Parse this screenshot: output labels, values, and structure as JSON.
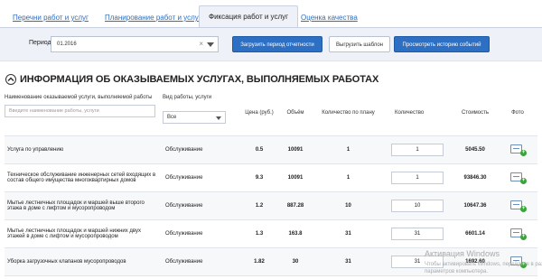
{
  "tabs": [
    {
      "label": "Перечни работ и услуг"
    },
    {
      "label": "Планирование работ и услуг"
    },
    {
      "label": "Фиксация работ и услуг"
    },
    {
      "label": "Оценка качества"
    }
  ],
  "filter": {
    "period_label": "Период",
    "period_value": "01.2016",
    "clear_glyph": "×",
    "load_button": "Загрузить период отчетности",
    "template_button": "Выгрузить шаблон",
    "history_button": "Просмотреть историю событий"
  },
  "section": {
    "title": "ИНФОРМАЦИЯ ОБ ОКАЗЫВАЕМЫХ УСЛУГАХ, ВЫПОЛНЯЕМЫХ РАБОТАХ"
  },
  "table": {
    "headers": {
      "name": "Наименование оказываемой услуги, выполняемой работы",
      "name_placeholder": "Введите наименование работы, услуги",
      "type": "Вид работы, услуги",
      "type_select": "Все",
      "price": "Цена (руб.)",
      "volume": "Объём",
      "planned": "Количество по плану",
      "quantity": "Количество",
      "cost": "Стоимость",
      "photo": "Фото"
    },
    "rows": [
      {
        "name": "Услуга по управлению",
        "type": "Обслуживание",
        "price": "0.5",
        "volume": "10091",
        "planned": "1",
        "quantity": "1",
        "cost": "5045.50"
      },
      {
        "name": "Техническое обслуживание инженерных сетей входящих в состав общего имущества многоквартирных домов",
        "type": "Обслуживание",
        "price": "9.3",
        "volume": "10091",
        "planned": "1",
        "quantity": "1",
        "cost": "93846.30"
      },
      {
        "name": "Мытье лестничных площадок и маршей выше второго этажа в доме с лифтом и мусоропроводом",
        "type": "Обслуживание",
        "price": "1.2",
        "volume": "887.28",
        "planned": "10",
        "quantity": "10",
        "cost": "10647.36"
      },
      {
        "name": "Мытье лестничных площадок и маршей нижних двух этажей в доме с лифтом и мусоропроводом",
        "type": "Обслуживание",
        "price": "1.3",
        "volume": "163.8",
        "planned": "31",
        "quantity": "31",
        "cost": "6601.14"
      },
      {
        "name": "Уборка загрузочных клапанов мусоропроводов",
        "type": "Обслуживание",
        "price": "1.82",
        "volume": "30",
        "planned": "31",
        "quantity": "31",
        "cost": "1692.60"
      }
    ]
  },
  "watermark": {
    "line1": "Активация Windows",
    "line2": "Чтобы активировать Windows, перейдите в раздел",
    "line3": "параметров компьютера."
  },
  "colors": {
    "accent": "#2d6fc3",
    "panel": "#eef1f7",
    "photo_plus": "#3aa33a"
  }
}
